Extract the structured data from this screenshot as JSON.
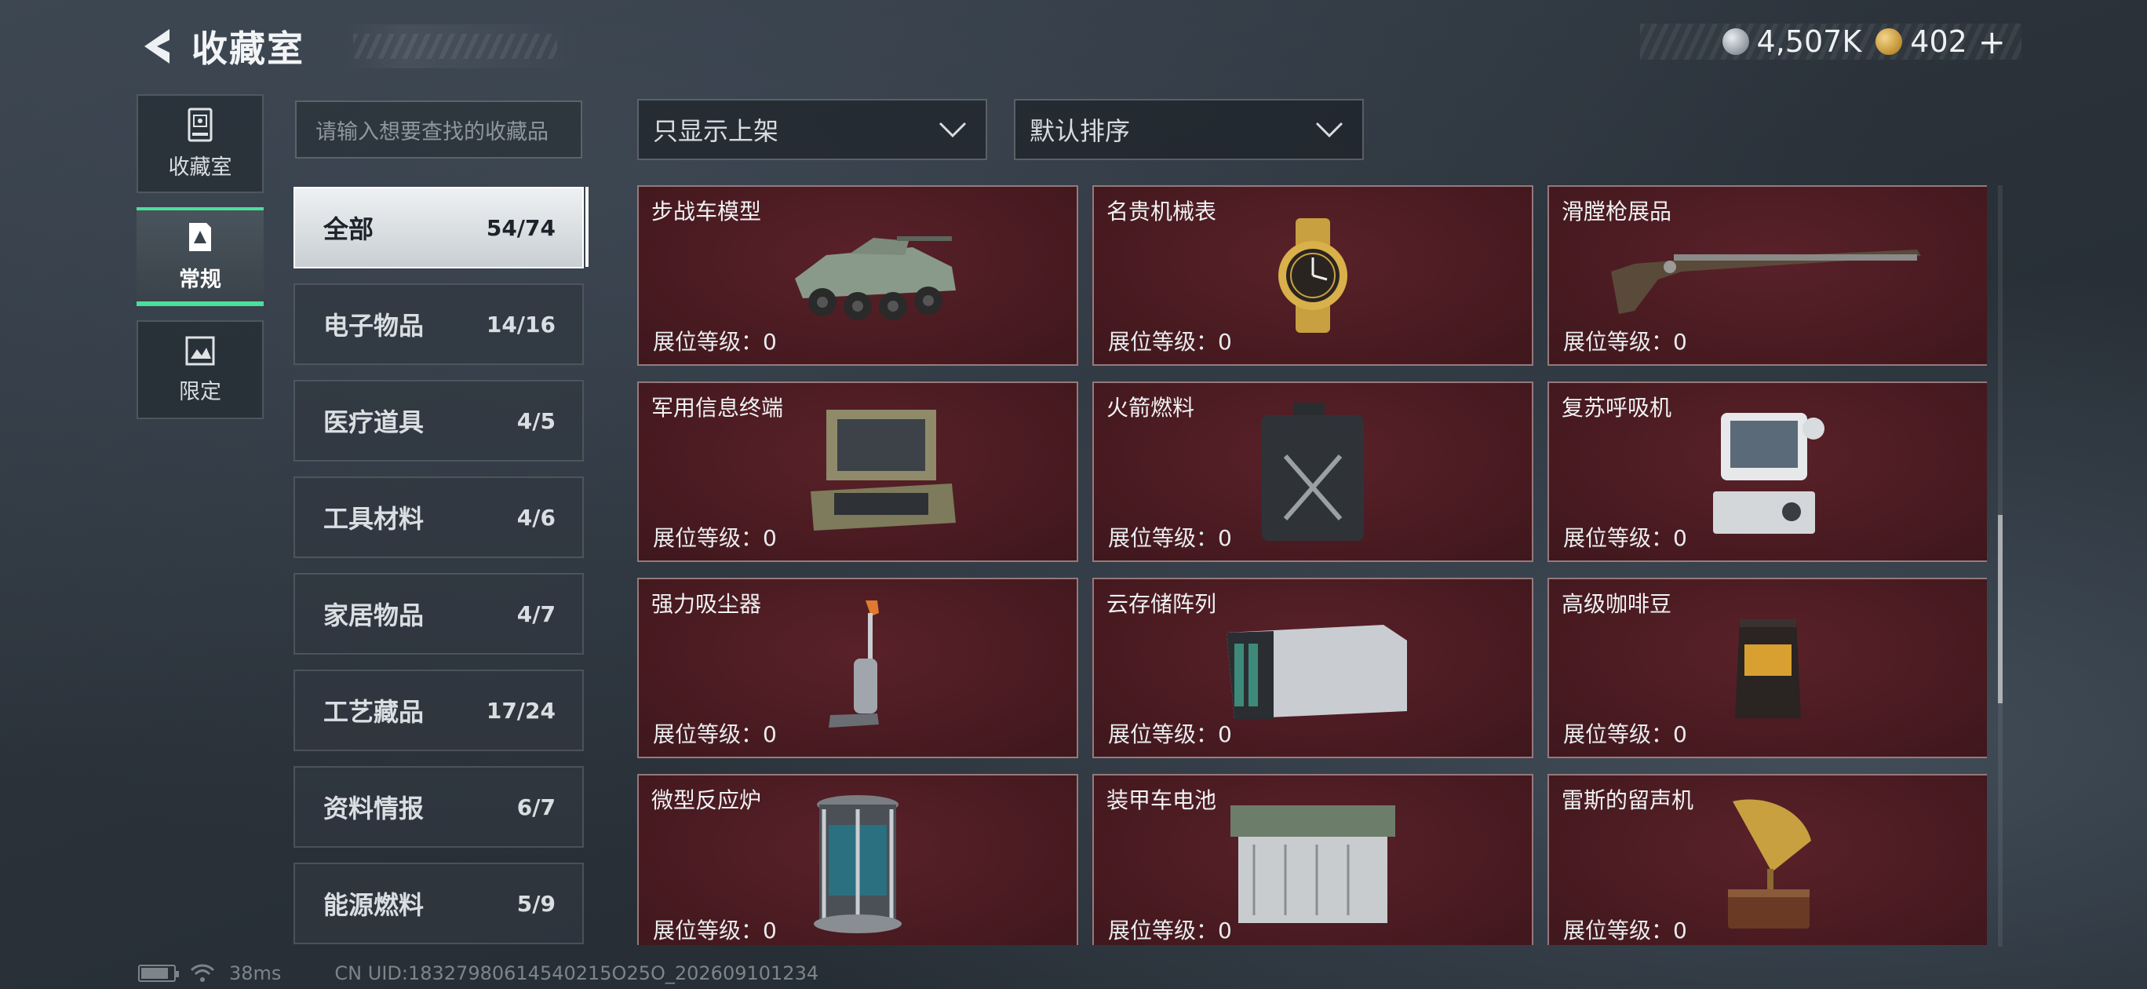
{
  "header": {
    "title": "收藏室"
  },
  "currency": {
    "silver": "4,507K",
    "gold": "402",
    "plus": "+"
  },
  "leftnav": {
    "items": [
      {
        "label": "收藏室"
      },
      {
        "label": "常规"
      },
      {
        "label": "限定"
      }
    ]
  },
  "search": {
    "placeholder": "请输入想要查找的收藏品"
  },
  "filters": {
    "shelf": "只显示上架",
    "sort": "默认排序"
  },
  "categories": [
    {
      "name": "全部",
      "count": "54/74"
    },
    {
      "name": "电子物品",
      "count": "14/16"
    },
    {
      "name": "医疗道具",
      "count": "4/5"
    },
    {
      "name": "工具材料",
      "count": "4/6"
    },
    {
      "name": "家居物品",
      "count": "4/7"
    },
    {
      "name": "工艺藏品",
      "count": "17/24"
    },
    {
      "name": "资料情报",
      "count": "6/7"
    },
    {
      "name": "能源燃料",
      "count": "5/9"
    }
  ],
  "items": [
    {
      "name": "步战车模型",
      "level": "展位等级：0"
    },
    {
      "name": "名贵机械表",
      "level": "展位等级：0"
    },
    {
      "name": "滑膛枪展品",
      "level": "展位等级：0"
    },
    {
      "name": "军用信息终端",
      "level": "展位等级：0"
    },
    {
      "name": "火箭燃料",
      "level": "展位等级：0"
    },
    {
      "name": "复苏呼吸机",
      "level": "展位等级：0"
    },
    {
      "name": "强力吸尘器",
      "level": "展位等级：0"
    },
    {
      "name": "云存储阵列",
      "level": "展位等级：0"
    },
    {
      "name": "高级咖啡豆",
      "level": "展位等级：0"
    },
    {
      "name": "微型反应炉",
      "level": "展位等级：0"
    },
    {
      "name": "装甲车电池",
      "level": "展位等级：0"
    },
    {
      "name": "雷斯的留声机",
      "level": "展位等级：0"
    }
  ],
  "footer": {
    "ping": "38ms",
    "uid": "CN UID:18327980614540215O25O_202609101234"
  },
  "colors": {
    "accent": "#4be09a",
    "card_bg": "#471a20"
  }
}
